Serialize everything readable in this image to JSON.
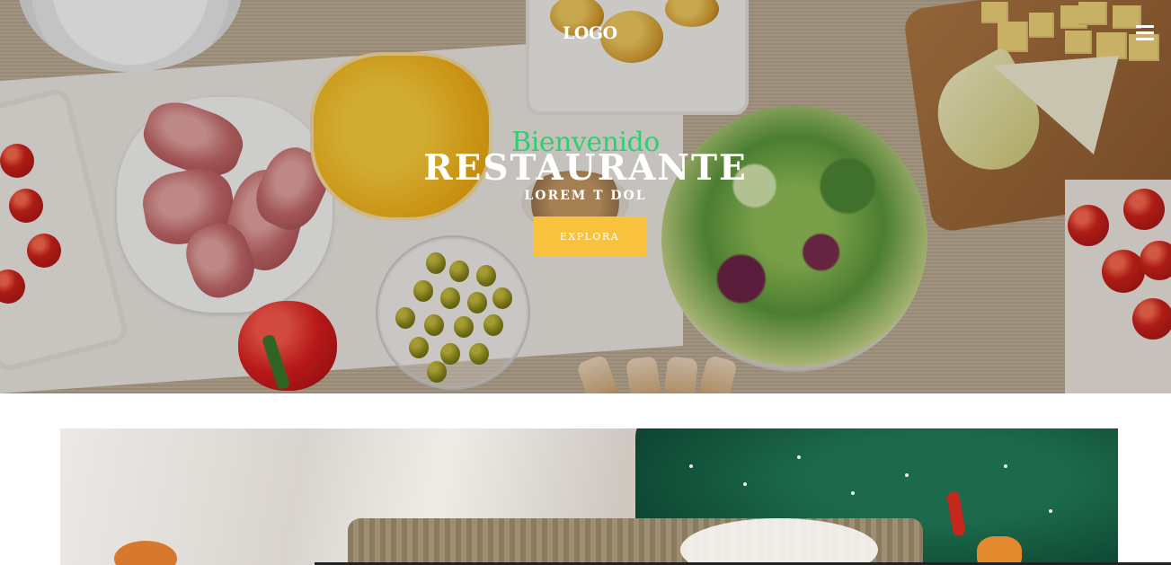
{
  "nav": {
    "logo": "LOGO",
    "menu_icon": "hamburger-menu-icon"
  },
  "hero": {
    "welcome": "Bienvenido",
    "brand": "RESTAURANTE",
    "tagline": "LOREM T DOL",
    "cta_label": "EXPLORA"
  },
  "colors": {
    "welcome_text": "#2fcf6f",
    "cta_background": "#f9c23c",
    "text_light": "#ffffff"
  }
}
